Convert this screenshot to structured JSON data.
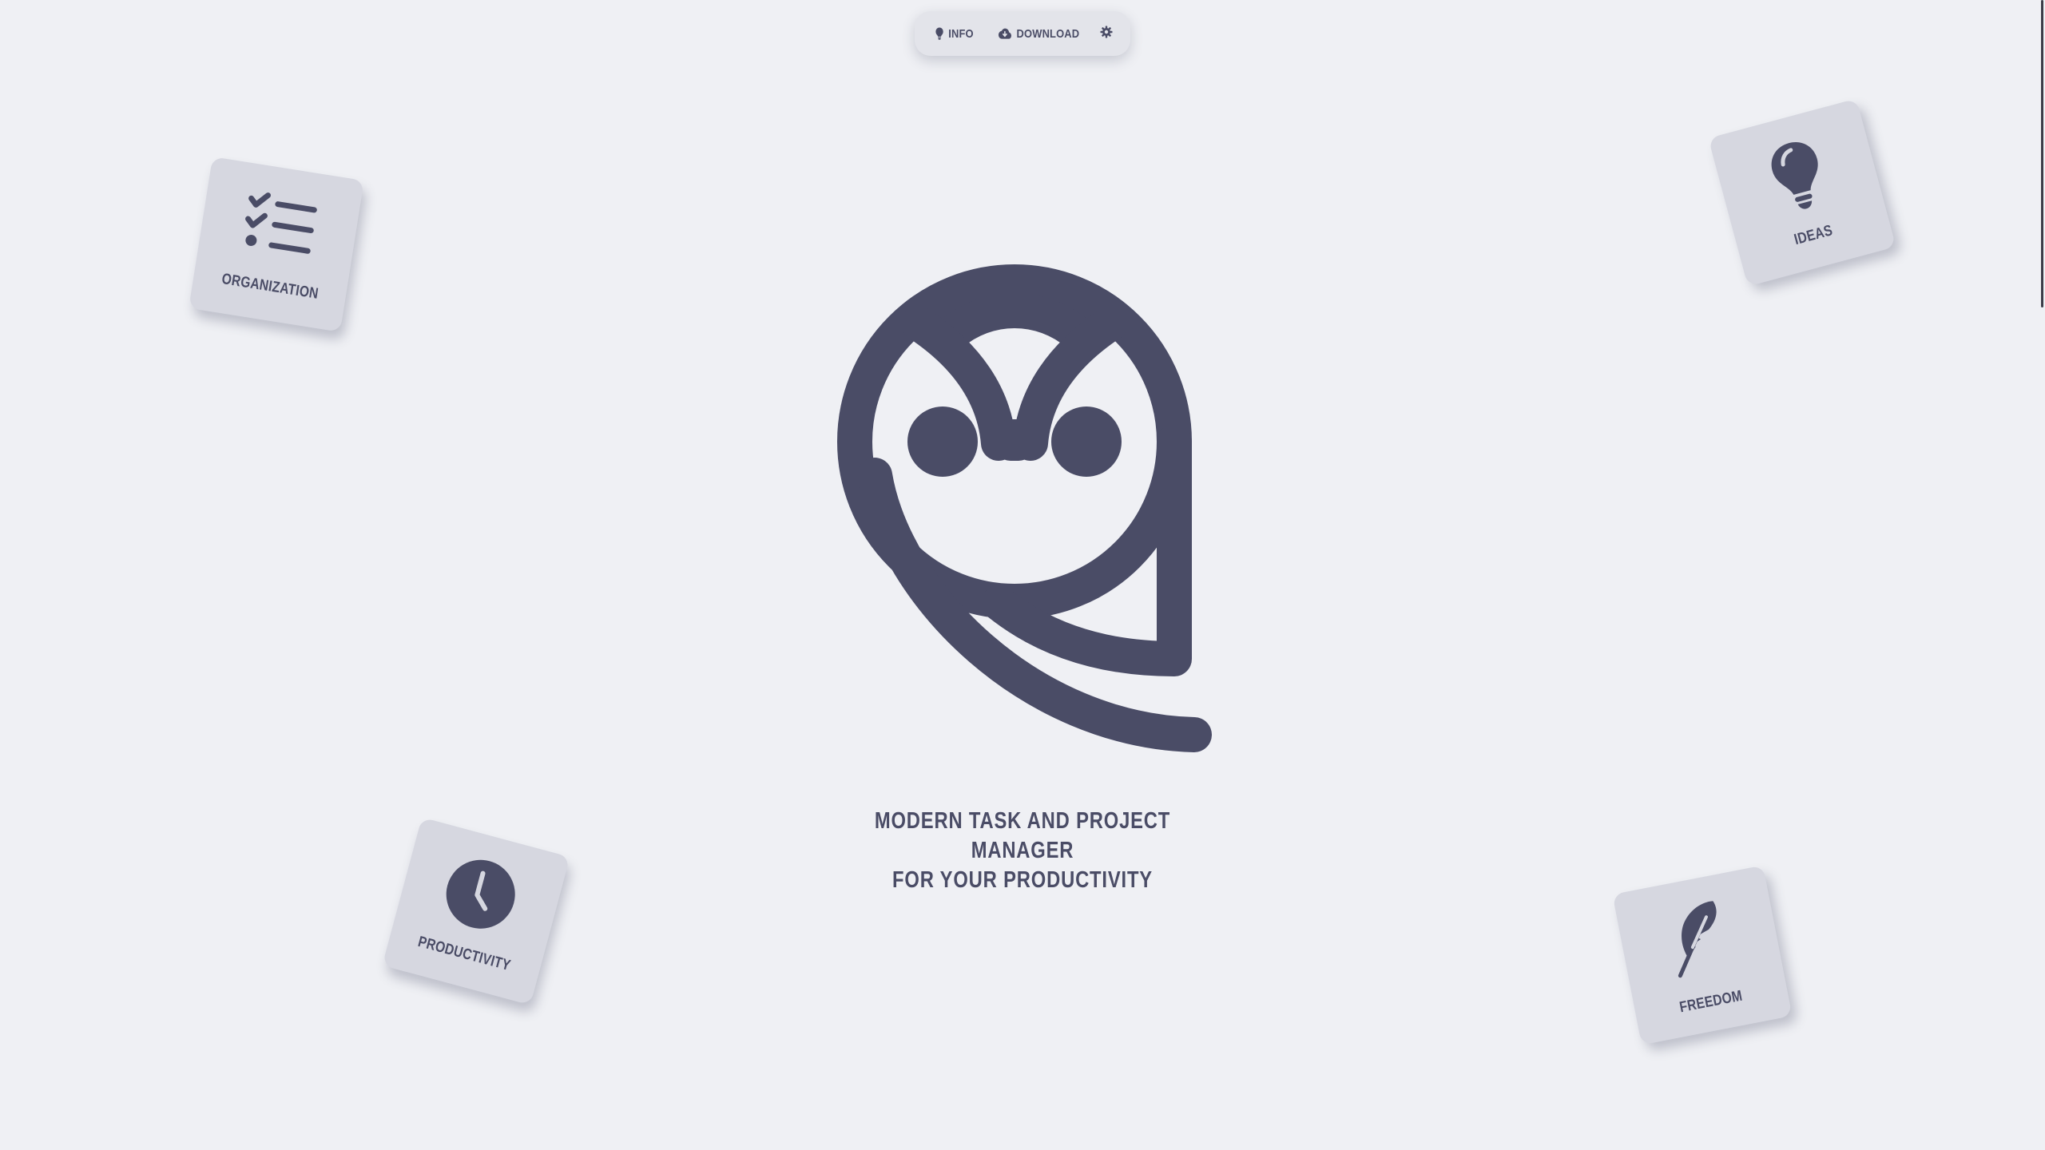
{
  "nav": {
    "info_label": "INFO",
    "download_label": "DOWNLOAD",
    "info_icon": "lightbulb-icon",
    "download_icon": "cloud-download-icon",
    "settings_icon": "gear-icon"
  },
  "cards": {
    "organization": {
      "label": "ORGANIZATION",
      "icon": "checklist-icon"
    },
    "ideas": {
      "label": "IDEAS",
      "icon": "lightbulb-icon"
    },
    "productivity": {
      "label": "PRODUCTIVITY",
      "icon": "clock-icon"
    },
    "freedom": {
      "label": "FREEDOM",
      "icon": "feather-icon"
    }
  },
  "hero": {
    "logo_icon": "owl-logo-icon",
    "tagline_line1": "MODERN TASK AND PROJECT MANAGER",
    "tagline_line2": "FOR YOUR PRODUCTIVITY"
  },
  "colors": {
    "background": "#eff0f4",
    "primary": "#4a4c66",
    "card": "#d6d7e0"
  }
}
